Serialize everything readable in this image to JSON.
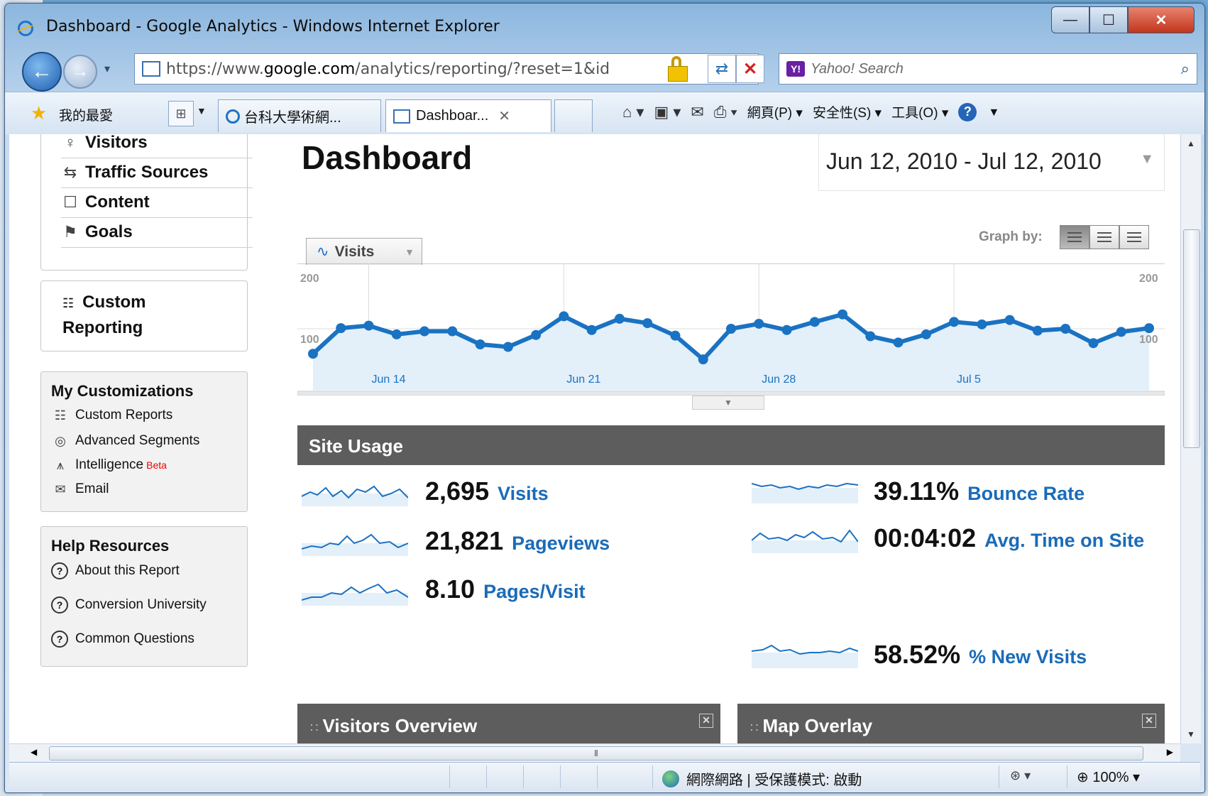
{
  "window": {
    "title": "Dashboard - Google Analytics - Windows Internet Explorer",
    "min": "—",
    "max": "☐",
    "close": "✕"
  },
  "address": {
    "url_prefix": "https://www.",
    "url_domain": "google.com",
    "url_rest": "/analytics/reporting/?reset=1&id",
    "search_placeholder": "Yahoo! Search",
    "yahoo_badge": "Y!"
  },
  "favorites": {
    "label": "我的最愛",
    "tab1": "台科大學術網...",
    "tab2": "Dashboar...",
    "tab2_close": "✕"
  },
  "commandbar": {
    "page": "網頁(P) ▾",
    "safety": "安全性(S) ▾",
    "tools": "工具(O) ▾"
  },
  "sidebar": {
    "nav": [
      {
        "icon": "person-icon",
        "label": "Visitors"
      },
      {
        "icon": "traffic-sources-icon",
        "label": "Traffic Sources"
      },
      {
        "icon": "content-icon",
        "label": "Content"
      },
      {
        "icon": "flag-icon",
        "label": "Goals"
      }
    ],
    "custom_reporting": [
      "Custom",
      "Reporting"
    ],
    "customizations": {
      "title": "My Customizations",
      "items": [
        "Custom Reports",
        "Advanced Segments",
        "Intelligence",
        "Email"
      ],
      "beta": "Beta"
    },
    "help": {
      "title": "Help Resources",
      "items": [
        "About this Report",
        "Conversion University",
        "Common Questions"
      ]
    }
  },
  "main": {
    "title": "Dashboard",
    "date_range": "Jun 12, 2010 - Jul 12, 2010",
    "metric_selector": "Visits",
    "graph_by": "Graph by:",
    "site_usage_title": "Site Usage",
    "stats": [
      {
        "value": "2,695",
        "label": "Visits"
      },
      {
        "value": "21,821",
        "label": "Pageviews"
      },
      {
        "value": "8.10",
        "label": "Pages/Visit"
      },
      {
        "value": "39.11%",
        "label": "Bounce Rate"
      },
      {
        "value": "00:04:02",
        "label": "Avg. Time on Site"
      },
      {
        "value": "58.52%",
        "label": "% New Visits"
      }
    ],
    "panels": [
      "Visitors Overview",
      "Map Overlay"
    ]
  },
  "chart_data": {
    "type": "line",
    "series": [
      {
        "values": [
          60,
          101,
          105,
          91,
          96,
          96,
          75,
          71,
          90,
          120,
          98,
          116,
          109,
          89,
          51,
          100,
          108,
          98,
          111,
          123,
          88,
          78,
          91,
          111,
          107,
          114,
          97,
          100,
          77,
          95,
          101
        ]
      }
    ],
    "x": [
      "Jun 12",
      "Jun 13",
      "Jun 14",
      "Jun 15",
      "Jun 16",
      "Jun 17",
      "Jun 18",
      "Jun 19",
      "Jun 20",
      "Jun 21",
      "Jun 22",
      "Jun 23",
      "Jun 24",
      "Jun 25",
      "Jun 26",
      "Jun 27",
      "Jun 28",
      "Jun 29",
      "Jun 30",
      "Jul 1",
      "Jul 2",
      "Jul 3",
      "Jul 4",
      "Jul 5",
      "Jul 6",
      "Jul 7",
      "Jul 8",
      "Jul 9",
      "Jul 10",
      "Jul 11",
      "Jul 12"
    ],
    "x_tick_labels": [
      "Jun 14",
      "Jun 21",
      "Jun 28",
      "Jul 5"
    ],
    "y_tick_labels": [
      "200",
      "100"
    ],
    "ylim": [
      0,
      200
    ],
    "grid": true,
    "line_color": "#1a72c2",
    "fill_color": "#e3eff9"
  },
  "status": {
    "zone": "網際網路 | 受保護模式: 啟動",
    "zoom": "100%"
  }
}
